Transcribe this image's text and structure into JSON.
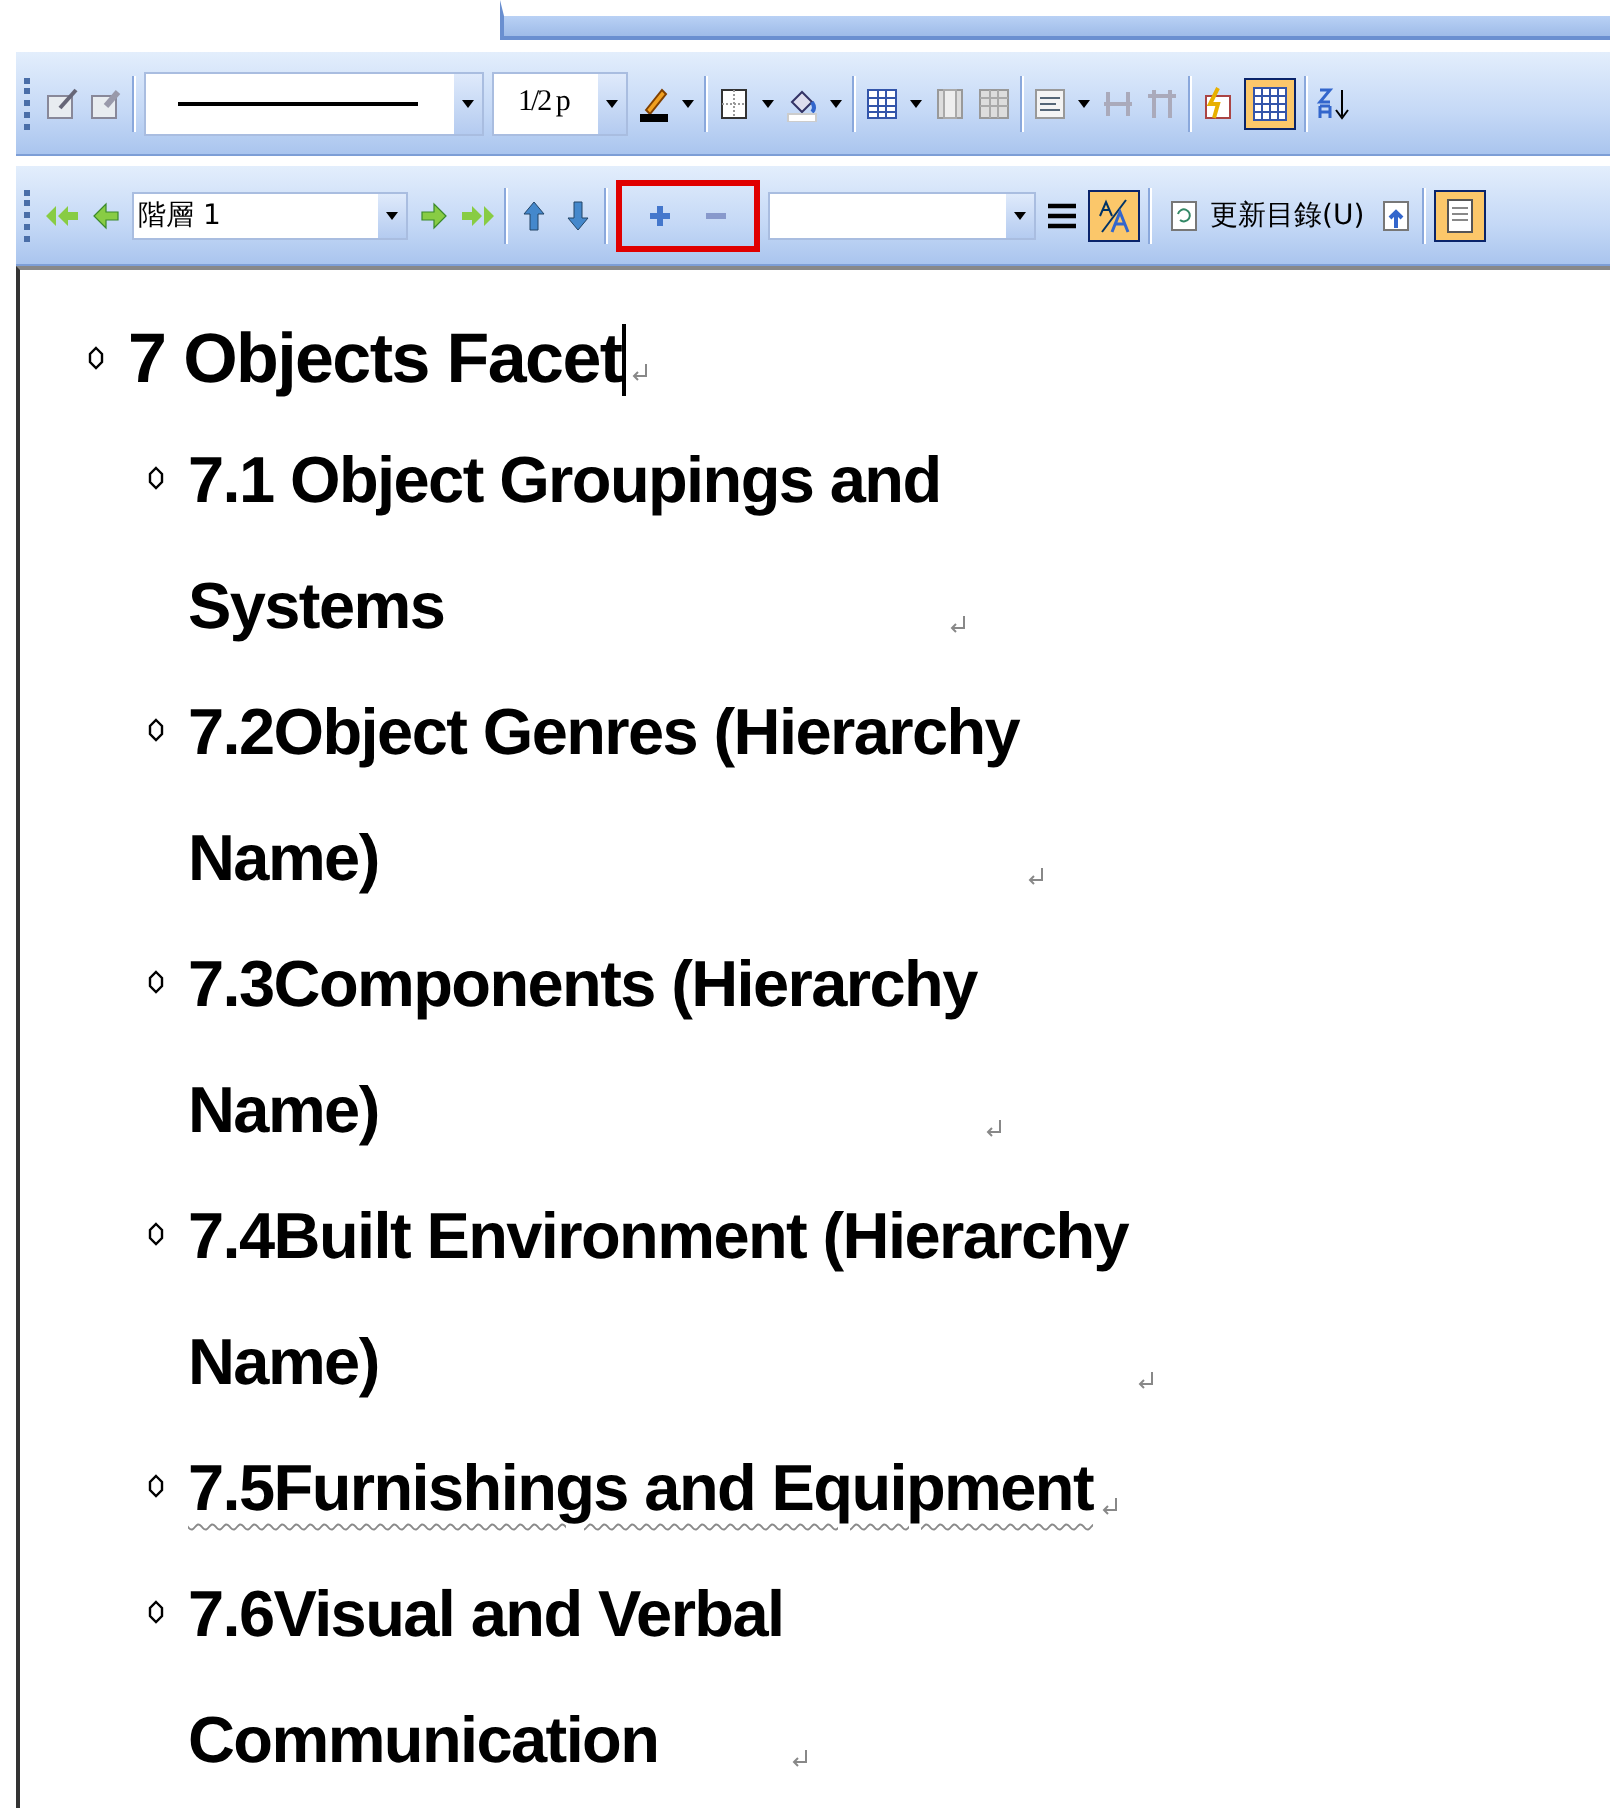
{
  "formatting_toolbar": {
    "line_weight": "1/2 p",
    "grid_button": {
      "selected": true
    }
  },
  "outlining_toolbar": {
    "level_combo": "階層 1",
    "show_formatting": {
      "selected": true
    },
    "update_toc": "更新目錄(U)",
    "document_map": {
      "selected": true
    },
    "expand_collapse_highlighted": true
  },
  "outline": [
    {
      "text": "7 Objects Facet",
      "cursor": true,
      "children": [
        {
          "text": "7.1 Object Groupings and Systems",
          "wavy_underline": false
        },
        {
          "text": "7.2Object Genres (Hierarchy Name)",
          "wavy_underline": false
        },
        {
          "text": "7.3Components (Hierarchy Name)",
          "wavy_underline": false
        },
        {
          "text": "7.4Built Environment (Hierarchy Name)",
          "wavy_underline": false
        },
        {
          "text": "7.5Furnishings and Equipment",
          "wavy_underline": true
        },
        {
          "text": "7.6Visual and Verbal Communication",
          "wavy_underline": false
        }
      ]
    }
  ]
}
